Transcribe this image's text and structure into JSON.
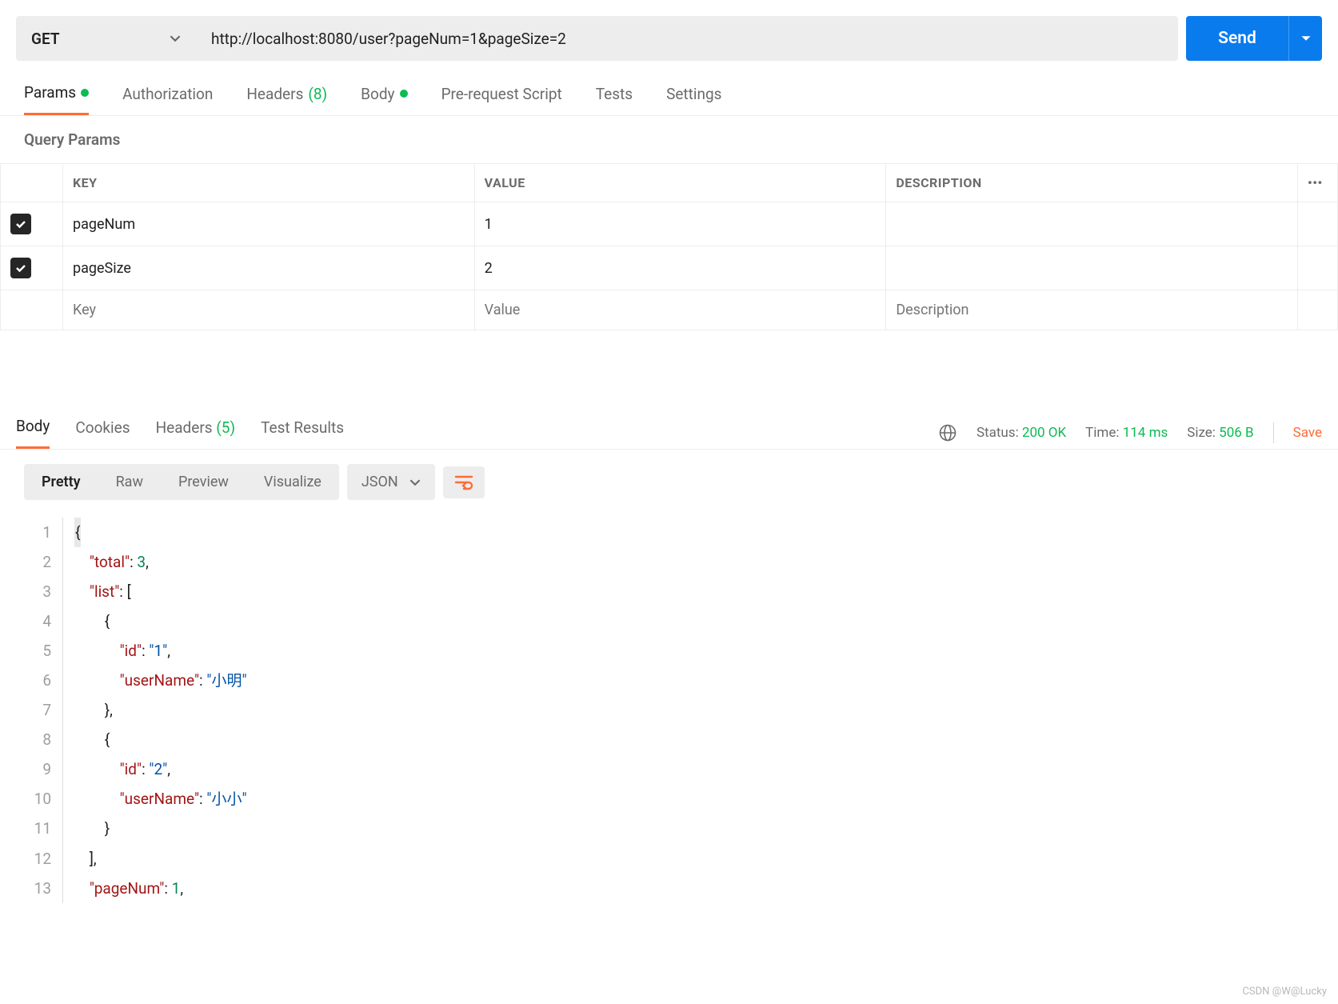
{
  "request": {
    "method": "GET",
    "url": "http://localhost:8080/user?pageNum=1&pageSize=2",
    "send_label": "Send"
  },
  "tabs": {
    "params": "Params",
    "authorization": "Authorization",
    "headers": "Headers",
    "headers_count": "(8)",
    "body": "Body",
    "prerequest": "Pre-request Script",
    "tests": "Tests",
    "settings": "Settings"
  },
  "section": {
    "query_params": "Query Params"
  },
  "params_table": {
    "headers": {
      "key": "KEY",
      "value": "VALUE",
      "description": "DESCRIPTION"
    },
    "rows": [
      {
        "checked": true,
        "key": "pageNum",
        "value": "1",
        "description": ""
      },
      {
        "checked": true,
        "key": "pageSize",
        "value": "2",
        "description": ""
      }
    ],
    "placeholders": {
      "key": "Key",
      "value": "Value",
      "description": "Description"
    }
  },
  "response_tabs": {
    "body": "Body",
    "cookies": "Cookies",
    "headers": "Headers",
    "headers_count": "(5)",
    "test_results": "Test Results"
  },
  "response_meta": {
    "status_label": "Status:",
    "status_value": "200 OK",
    "time_label": "Time:",
    "time_value": "114 ms",
    "size_label": "Size:",
    "size_value": "506 B",
    "save": "Save"
  },
  "viewer": {
    "pretty": "Pretty",
    "raw": "Raw",
    "preview": "Preview",
    "visualize": "Visualize",
    "format": "JSON"
  },
  "json_body": {
    "total": 3,
    "list": [
      {
        "id": "1",
        "userName": "小明"
      },
      {
        "id": "2",
        "userName": "小小"
      }
    ],
    "pageNum": 1
  },
  "code_lines": [
    {
      "n": 1,
      "indent": 0,
      "h": "{"
    },
    {
      "n": 2,
      "indent": 1,
      "k": "\"total\"",
      "p1": ": ",
      "v": "3",
      "vt": "n",
      "p2": ","
    },
    {
      "n": 3,
      "indent": 1,
      "k": "\"list\"",
      "p1": ": [",
      "v": "",
      "vt": "p",
      "p2": ""
    },
    {
      "n": 4,
      "indent": 2,
      "raw": "{"
    },
    {
      "n": 5,
      "indent": 3,
      "k": "\"id\"",
      "p1": ": ",
      "v": "\"1\"",
      "vt": "s",
      "p2": ","
    },
    {
      "n": 6,
      "indent": 3,
      "k": "\"userName\"",
      "p1": ": ",
      "v": "\"小明\"",
      "vt": "s",
      "p2": ""
    },
    {
      "n": 7,
      "indent": 2,
      "raw": "},"
    },
    {
      "n": 8,
      "indent": 2,
      "raw": "{"
    },
    {
      "n": 9,
      "indent": 3,
      "k": "\"id\"",
      "p1": ": ",
      "v": "\"2\"",
      "vt": "s",
      "p2": ","
    },
    {
      "n": 10,
      "indent": 3,
      "k": "\"userName\"",
      "p1": ": ",
      "v": "\"小小\"",
      "vt": "s",
      "p2": ""
    },
    {
      "n": 11,
      "indent": 2,
      "raw": "}"
    },
    {
      "n": 12,
      "indent": 1,
      "raw": "],"
    },
    {
      "n": 13,
      "indent": 1,
      "k": "\"pageNum\"",
      "p1": ": ",
      "v": "1",
      "vt": "n",
      "p2": ","
    }
  ],
  "watermark": "CSDN @W@Lucky"
}
